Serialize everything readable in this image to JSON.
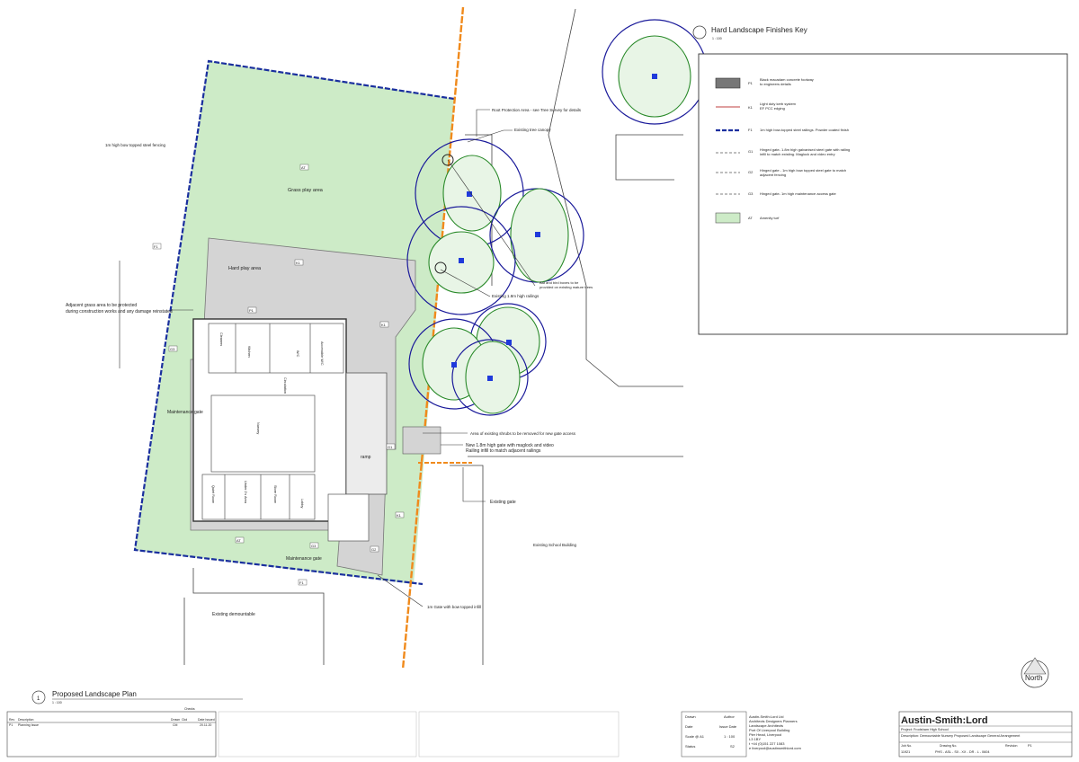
{
  "colors": {
    "grass": "#cdebc7",
    "hard": "#d4d4d4",
    "boundary": "#1a2f9e",
    "orange": "#f08a1c",
    "canopy_blue": "#1a1a9a",
    "canopy_green": "#2a8a2a",
    "tree_marker": "#1f3adb",
    "macadam": "#777777"
  },
  "key": {
    "title": "Hard Landscape Finishes Key",
    "scale": "1 : 100",
    "items": [
      {
        "code": "P1",
        "text1": "Black macadam concrete footway",
        "text2": "to engineers details"
      },
      {
        "code": "K1",
        "text1": "Light duty kerb system",
        "text2": "EF PCC edging"
      },
      {
        "code": "F1",
        "text1": "1m high bow-topped steel railings. Powder coated finish",
        "text2": ""
      },
      {
        "code": "G1",
        "text1": "Hinged gate- 1.8m high galvanised steel gate with railing",
        "text2": "infill to match existing. Maglock and video entry"
      },
      {
        "code": "G2",
        "text1": "Hinged gate - 1m high bow topped steel gate to match",
        "text2": "adjacent fencing"
      },
      {
        "code": "G3",
        "text1": "Hinged gate- 1m high maintenance access gate",
        "text2": ""
      },
      {
        "code": "AT",
        "text1": "Amenity turf",
        "text2": ""
      }
    ]
  },
  "plan": {
    "title": "Proposed Landscape Plan",
    "number": "1",
    "scale": "1 : 100",
    "labels": {
      "fencing": "1m high bow topped steel fencing",
      "grass_play": "Grass play area",
      "hard_play": "Hard play area",
      "adjacent_grass_1": "Adjacent grass area to be protected",
      "adjacent_grass_2": "during construction works and any damage reinstated",
      "maintenance_gate_w": "Maintenance gate",
      "maintenance_gate_s": "Maintenance gate",
      "root_protection": "Root Protection Area - see Tree Survey for details",
      "existing_canopy": "Existing tree canopy",
      "bat_boxes_1": "Bat and bird boxes to be",
      "bat_boxes_2": "provided on existing mature trees",
      "existing_railings": "Existing 1.8m high railings",
      "shrubs": "Area of existing shrubs to be removed for new gate access",
      "new_gate_1": "New 1.8m high gate with maglock and video",
      "new_gate_2": "Railing infill to match adjacent railings",
      "existing_gate": "Existing gate",
      "school_building": "Existing School Building",
      "demountable": "Existing demountable",
      "gate_infill": "1m Gate with bow topped infill",
      "ramp": "ramp",
      "nursery": "Nursery",
      "kitchen": "Kitchen",
      "circulation": "Circulation",
      "wc": "W/C",
      "accessible_wc": "Accessible W/C",
      "cleaners": "Cleaners",
      "quiet_room": "Quiet Room",
      "under2s": "Under 2's Area",
      "store": "Store Room",
      "lobby": "Lobby"
    },
    "tags": {
      "AT": "AT",
      "F1": "F1",
      "K1": "K1",
      "P1": "P1",
      "G1": "G1",
      "G2": "G2",
      "G3": "G3"
    }
  },
  "north": "North",
  "title_block": {
    "company": "Austin-Smith:Lord",
    "company_lines": [
      "Austin-Smith:Lord Ltd",
      "Architects Designers Planners",
      "Landscape Architects",
      "Port Of Liverpool Building",
      "Pier Head, Liverpool",
      "L3 1BY",
      "t +44 (0)151 227 1083",
      "e liverpool@austinsmithlord.com"
    ],
    "project": "Project: Frodsham High School",
    "description": "Description: Demountable Nursery Proposed Landscape General Arrangement",
    "drawn_label": "Drawn",
    "drawn_value": "Author",
    "date_label": "Date",
    "date_value": "Issue Date",
    "scale_label": "Scale @ A1",
    "scale_value": "1 : 100",
    "status_label": "Status",
    "status_value": "S2",
    "job_no_label": "Job No.",
    "job_no": "11921",
    "drawing_no_label": "Drawing No.",
    "drawing_no": "PHS - ASL - S0 - XX - DR - L - 0604",
    "revision_label": "Revision",
    "revision": "P1",
    "checks_header": "Checks",
    "rev_headers": [
      "Rev",
      "Description",
      "Drawn",
      "Ckd",
      "Date Issued"
    ],
    "rev_row": [
      "P1",
      "Planning Issue",
      "CM",
      "",
      "20.11.20"
    ]
  }
}
